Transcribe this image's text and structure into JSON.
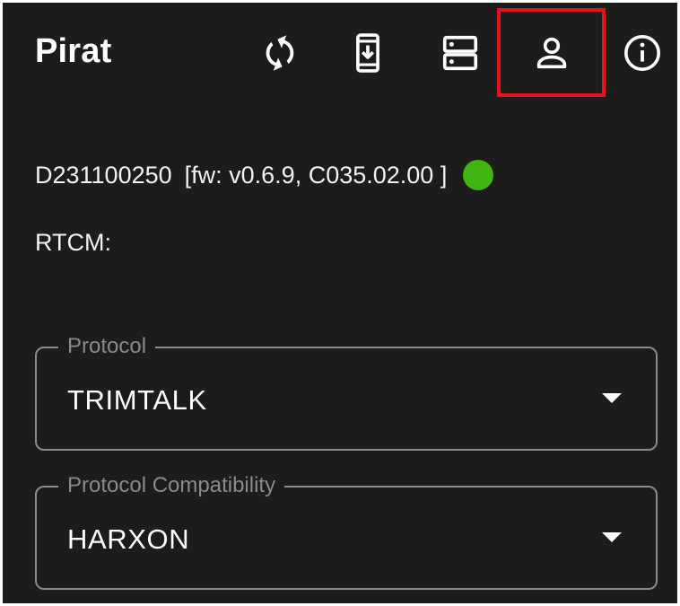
{
  "app": {
    "title": "Pirat"
  },
  "toolbar": {
    "buttons": [
      {
        "icon": "refresh-icon"
      },
      {
        "icon": "install-to-device-icon"
      },
      {
        "icon": "server-icon"
      },
      {
        "icon": "account-icon",
        "highlighted": true
      },
      {
        "icon": "info-icon"
      }
    ],
    "highlight_color": "#e4131b"
  },
  "device": {
    "id": "D231100250",
    "firmware": "[fw: v0.6.9, C035.02.00 ]",
    "status_color": "#3fb512"
  },
  "rtcm": {
    "label": "RTCM:"
  },
  "protocol": {
    "label": "Protocol",
    "value": "TRIMTALK"
  },
  "compatibility": {
    "label": "Protocol Compatibility",
    "value": "HARXON"
  },
  "colors": {
    "background": "#1c1c1c",
    "text": "#ffffff",
    "muted": "#8a8a8a"
  }
}
